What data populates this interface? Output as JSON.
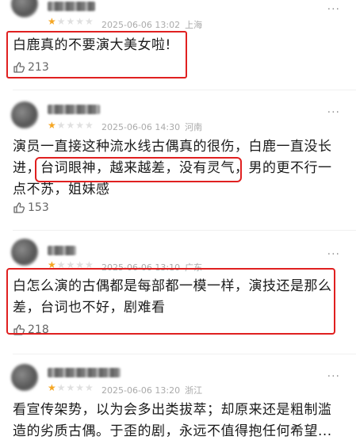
{
  "comments": [
    {
      "stars_filled": 1,
      "stars_total": 5,
      "date": "2025-06-06 13:02",
      "location": "上海",
      "text": "白鹿真的不要演大美女啦!",
      "likes": "213"
    },
    {
      "stars_filled": 1,
      "stars_total": 5,
      "date": "2025-06-06 14:30",
      "location": "河南",
      "text_line1": "演员一直接这种流水线古偶真的很伤，白鹿一直没长",
      "text_line2_pre": "进，",
      "text_line2_highlight": "台词眼神，越来越差，没有灵气",
      "text_line2_post": "，男的更不行一",
      "text_line3": "点不苏，姐妹感",
      "likes": "153"
    },
    {
      "stars_filled": 1,
      "stars_total": 5,
      "date": "2025-06-06 13:10",
      "location": "广东",
      "text_line1": "白怎么演的古偶都是每部都一模一样，演技还是那么",
      "text_line2": "差，台词也不好，剧难看",
      "likes": "218"
    },
    {
      "stars_filled": 1,
      "stars_total": 5,
      "date": "2025-06-06 13:20",
      "location": "浙江",
      "text_line1": "看宣传架势，以为会多出类拔萃；却原来还是粗制滥",
      "text_line2": "造的劣质古偶。于歪的剧，永远不值得抱任何希望..."
    }
  ],
  "icons": {
    "like": "thumbs-up-icon",
    "more": "more-dots-icon",
    "star": "star-icon"
  },
  "colors": {
    "highlight_box": "#e02020",
    "star": "#f5a623"
  }
}
